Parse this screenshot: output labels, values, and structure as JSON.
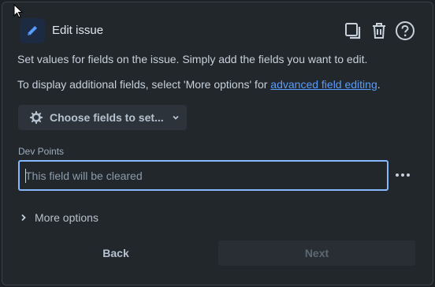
{
  "dialog": {
    "title": "Edit issue",
    "icons": {
      "app": "pencil-icon",
      "copy": "copy-icon",
      "delete": "trash-icon",
      "help": "help-icon"
    }
  },
  "description": {
    "line1": "Set values for fields on the issue. Simply add the fields you want to edit.",
    "line2_prefix": "To display additional fields, select 'More options' for ",
    "line2_link": "advanced field editing",
    "line2_suffix": "."
  },
  "choose_fields": {
    "label": "Choose fields to set...",
    "icon": "gear-icon",
    "chevron_icon": "chevron-down-icon"
  },
  "field": {
    "label": "Dev Points",
    "value": "",
    "placeholder": "This field will be cleared",
    "more_icon": "more-icon"
  },
  "more_options": {
    "label": "More options",
    "icon": "chevron-right-icon"
  },
  "footer": {
    "back_label": "Back",
    "next_label": "Next",
    "next_disabled": true
  },
  "colors": {
    "background": "#22272b",
    "accent": "#579dff",
    "focus_border": "#85b8ff",
    "text": "#c7d1db"
  }
}
